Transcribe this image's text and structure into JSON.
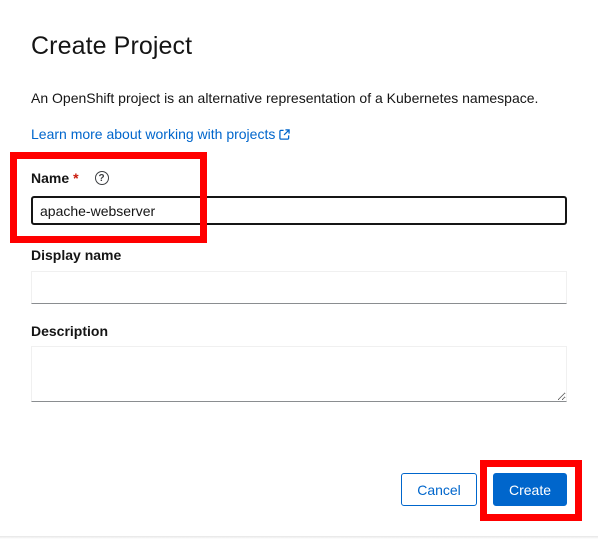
{
  "modal": {
    "title": "Create Project",
    "description": "An OpenShift project is an alternative representation of a Kubernetes namespace.",
    "learn_more": "Learn more about working with projects",
    "learn_more_icon": "external-link-icon"
  },
  "form": {
    "name_label": "Name",
    "required_marker": "*",
    "help_icon": "question-circle-icon",
    "help_glyph": "?",
    "name_value": "apache-webserver",
    "display_name_label": "Display name",
    "display_name_value": "",
    "description_label": "Description",
    "description_value": ""
  },
  "actions": {
    "cancel_label": "Cancel",
    "create_label": "Create"
  },
  "colors": {
    "link": "#0066cc",
    "primary": "#0066cc",
    "required": "#c9190b",
    "highlight": "#ff0000"
  }
}
